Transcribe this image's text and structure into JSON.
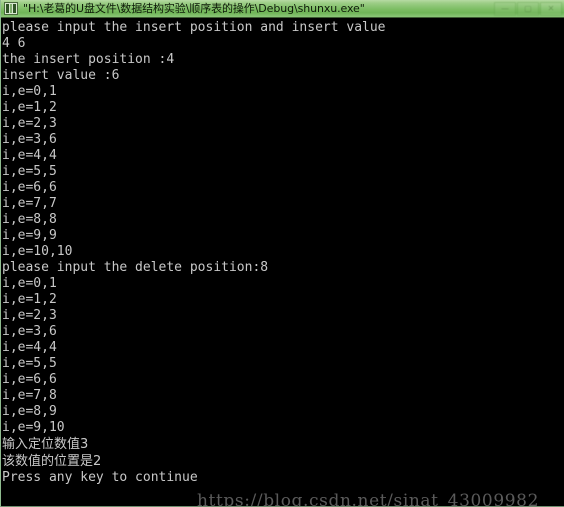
{
  "window": {
    "title": "\"H:\\老葛的U盘文件\\数据结构实验\\顺序表的操作\\Debug\\shunxu.exe\"",
    "icon": "console-window-icon",
    "titlebar_color": "#7cbd63",
    "background_color": "#000000",
    "text_color": "#c8c8c8",
    "controls": [
      {
        "name": "minimize",
        "glyph": "—"
      },
      {
        "name": "maximize",
        "glyph": "▢"
      },
      {
        "name": "close",
        "glyph": "✕"
      }
    ]
  },
  "console": {
    "lines": [
      {
        "text": "please input the insert position and insert value",
        "cjk": false
      },
      {
        "text": "4 6",
        "cjk": false
      },
      {
        "text": "the insert position :4",
        "cjk": false
      },
      {
        "text": "insert value :6",
        "cjk": false
      },
      {
        "text": "i,e=0,1",
        "cjk": false
      },
      {
        "text": "i,e=1,2",
        "cjk": false
      },
      {
        "text": "i,e=2,3",
        "cjk": false
      },
      {
        "text": "i,e=3,6",
        "cjk": false
      },
      {
        "text": "i,e=4,4",
        "cjk": false
      },
      {
        "text": "i,e=5,5",
        "cjk": false
      },
      {
        "text": "i,e=6,6",
        "cjk": false
      },
      {
        "text": "i,e=7,7",
        "cjk": false
      },
      {
        "text": "i,e=8,8",
        "cjk": false
      },
      {
        "text": "i,e=9,9",
        "cjk": false
      },
      {
        "text": "i,e=10,10",
        "cjk": false
      },
      {
        "text": "please input the delete position:8",
        "cjk": false
      },
      {
        "text": "i,e=0,1",
        "cjk": false
      },
      {
        "text": "i,e=1,2",
        "cjk": false
      },
      {
        "text": "i,e=2,3",
        "cjk": false
      },
      {
        "text": "i,e=3,6",
        "cjk": false
      },
      {
        "text": "i,e=4,4",
        "cjk": false
      },
      {
        "text": "i,e=5,5",
        "cjk": false
      },
      {
        "text": "i,e=6,6",
        "cjk": false
      },
      {
        "text": "i,e=7,8",
        "cjk": false
      },
      {
        "text": "i,e=8,9",
        "cjk": false
      },
      {
        "text": "i,e=9,10",
        "cjk": false
      },
      {
        "text": "输入定位数值3",
        "cjk": true
      },
      {
        "text": "该数值的位置是2",
        "cjk": true
      },
      {
        "text": "Press any key to continue",
        "cjk": false
      }
    ]
  },
  "watermark": {
    "text": "https://blog.csdn.net/sinat_43009982"
  }
}
